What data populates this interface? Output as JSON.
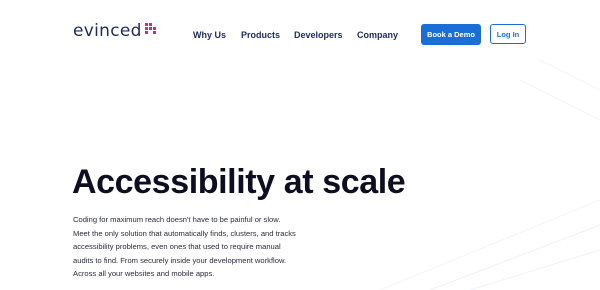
{
  "brand": {
    "name": "evinced",
    "colors": {
      "navy": "#1f2a5a",
      "accent_blue": "#1a6fd6",
      "logo_dots": [
        "#e0247a",
        "#e0247a",
        "#ffffff",
        "#e0247a",
        "#c02aa0",
        "#e0247a",
        "#e0247a",
        "#ffffff",
        "#7b3fd6"
      ]
    }
  },
  "nav": {
    "items": [
      {
        "label": "Why Us"
      },
      {
        "label": "Products"
      },
      {
        "label": "Developers"
      },
      {
        "label": "Company"
      }
    ],
    "cta_label": "Book a Demo",
    "login_label": "Log In"
  },
  "hero": {
    "title": "Accessibility at scale",
    "description": "Coding for maximum reach doesn't have to be painful or slow. Meet the only solution that automatically finds, clusters, and tracks accessibility problems, even ones that used to require manual audits to find. From securely inside your development workflow. Across all your websites and mobile apps."
  }
}
